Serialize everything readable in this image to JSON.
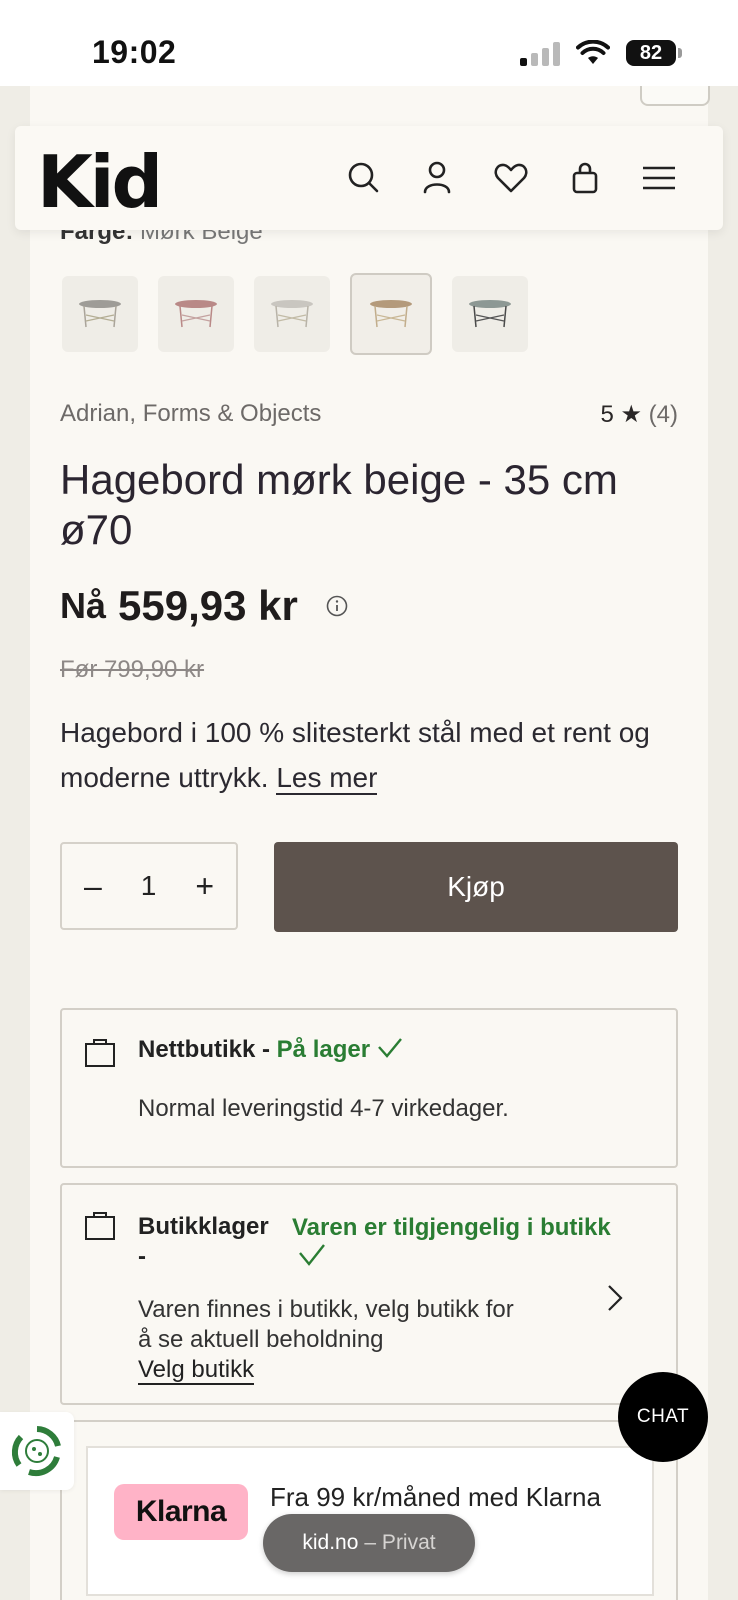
{
  "status_bar": {
    "time": "19:02",
    "battery": "82"
  },
  "header": {
    "logo": "Kid"
  },
  "product": {
    "color_label": "Farge:",
    "color_value": "Mørk Beige",
    "brand": "Adrian, Forms & Objects",
    "rating": "5 ★",
    "review_count": "(4)",
    "title": "Hagebord mørk beige - 35 cm ø70",
    "price_prefix": "Nå",
    "price": "559,93 kr",
    "old_price": "Før 799,90 kr",
    "description": "Hagebord i 100 % slitesterkt stål med et rent og moderne uttrykk.",
    "read_more": "Les mer",
    "quantity": "1",
    "buy_label": "Kjøp",
    "swatch_colors": [
      "#9e9c97",
      "#b98987",
      "#c9c6c0",
      "#b49a7b",
      "#8d9894"
    ]
  },
  "stock": {
    "online": {
      "title": "Nettbutikk -",
      "status": "På lager",
      "text": "Normal leveringstid 4-7 virkedager."
    },
    "store": {
      "title_1": "Butikklager",
      "title_2": "-",
      "status": "Varen er tilgjengelig i butikk",
      "text_1": "Varen finnes i butikk, velg butikk for",
      "text_2": "å se aktuell beholdning",
      "link": "Velg butikk"
    }
  },
  "klarna": {
    "logo": "Klarna",
    "text": "Fra 99 kr/måned med Klarna"
  },
  "chat": {
    "label": "CHAT"
  },
  "url_bar": {
    "domain": "kid.no",
    "mode": "– Privat"
  }
}
